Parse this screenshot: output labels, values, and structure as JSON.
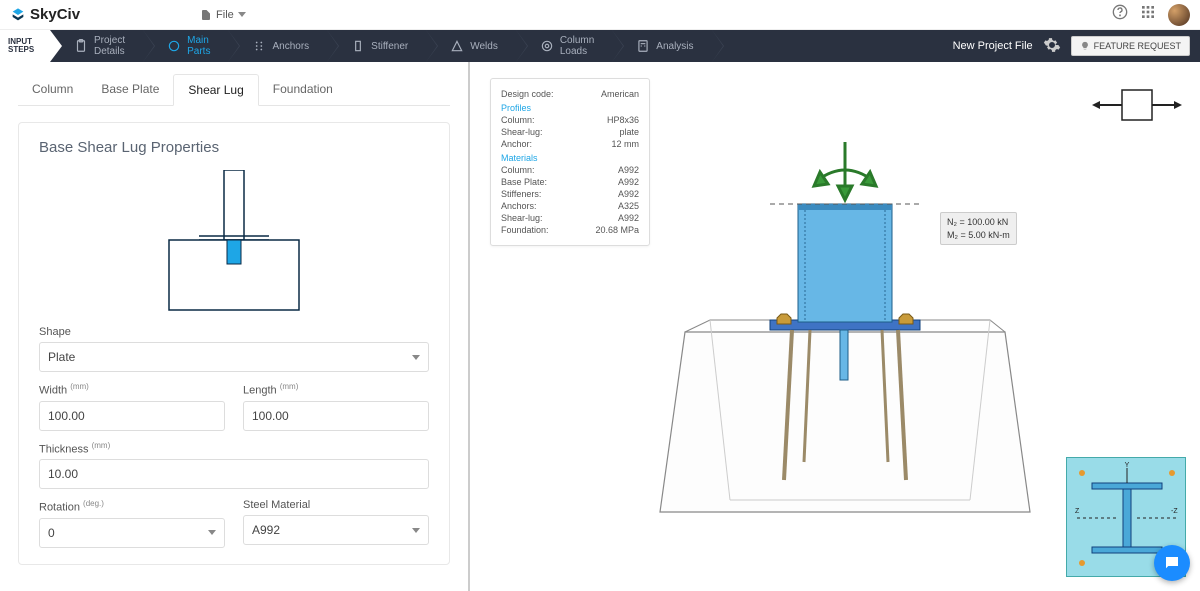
{
  "app": {
    "name": "SkyCiv"
  },
  "topbar": {
    "file_label": "File"
  },
  "steps": {
    "start_line1": "INPUT",
    "start_line2": "STEPS",
    "items": [
      {
        "l1": "Project",
        "l2": "Details"
      },
      {
        "l1": "Main",
        "l2": "Parts"
      },
      {
        "l1": "Anchors",
        "l2": ""
      },
      {
        "l1": "Stiffener",
        "l2": ""
      },
      {
        "l1": "Welds",
        "l2": ""
      },
      {
        "l1": "Column",
        "l2": "Loads"
      },
      {
        "l1": "Analysis",
        "l2": ""
      }
    ],
    "new_project": "New Project File",
    "feature_request": "FEATURE REQUEST"
  },
  "tabs": [
    "Column",
    "Base Plate",
    "Shear Lug",
    "Foundation"
  ],
  "panel": {
    "title": "Base Shear Lug Properties",
    "shape_label": "Shape",
    "shape_value": "Plate",
    "width_label": "Width",
    "width_unit": "(mm)",
    "width_value": "100.00",
    "length_label": "Length",
    "length_unit": "(mm)",
    "length_value": "100.00",
    "thick_label": "Thickness",
    "thick_unit": "(mm)",
    "thick_value": "10.00",
    "rot_label": "Rotation",
    "rot_unit": "(deg.)",
    "rot_value": "0",
    "mat_label": "Steel Material",
    "mat_value": "A992"
  },
  "info": {
    "design_code": {
      "k": "Design code:",
      "v": "American"
    },
    "profiles_hdr": "Profiles",
    "column": {
      "k": "Column:",
      "v": "HP8x36"
    },
    "shearlug": {
      "k": "Shear-lug:",
      "v": "plate"
    },
    "anchor": {
      "k": "Anchor:",
      "v": "12 mm"
    },
    "materials_hdr": "Materials",
    "m_column": {
      "k": "Column:",
      "v": "A992"
    },
    "m_baseplate": {
      "k": "Base Plate:",
      "v": "A992"
    },
    "m_stiff": {
      "k": "Stiffeners:",
      "v": "A992"
    },
    "m_anchors": {
      "k": "Anchors:",
      "v": "A325"
    },
    "m_shearlug": {
      "k": "Shear-lug:",
      "v": "A992"
    },
    "m_found": {
      "k": "Foundation:",
      "v": "20.68 MPa"
    }
  },
  "loads": {
    "n": "N₂ = 100.00 kN",
    "m": "M₂ = 5.00 kN-m"
  },
  "mini_bottom": {
    "y": "Y",
    "z1": "Z",
    "z2": "-Z"
  }
}
